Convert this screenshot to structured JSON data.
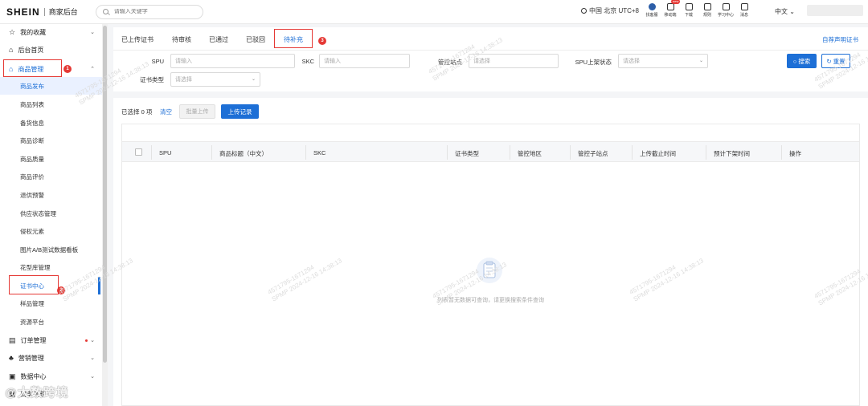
{
  "header": {
    "logo": "SHEIN",
    "subtitle": "商家后台",
    "search_placeholder": "请输入关键字",
    "region": "中国 北京 UTC+8",
    "tools": [
      "找客服",
      "移动端",
      "下载",
      "规则",
      "学习中心",
      "消息"
    ],
    "new_badge": "new",
    "language": "中文"
  },
  "sidebar": {
    "favorites": "我的收藏",
    "home": "后台首页",
    "product_mgmt": "商品管理",
    "sub_items": [
      "商品发布",
      "商品列表",
      "备货信息",
      "商品诊断",
      "商品质量",
      "商品评价",
      "退供预警",
      "供应状态管理",
      "侵权元素",
      "图片A/B测试数据看板",
      "花型库管理",
      "证书中心",
      "样品管理",
      "资源平台"
    ],
    "order_mgmt": "订单管理",
    "marketing_mgmt": "营销管理",
    "data_center": "数据中心",
    "finance_mgmt": "财务管理"
  },
  "annotations": [
    "1",
    "2",
    "3"
  ],
  "tabs": [
    "已上传证书",
    "待审核",
    "已通过",
    "已驳回",
    "待补充"
  ],
  "right_link": "自荐声明证书",
  "filters": {
    "spu_label": "SPU",
    "spu_placeholder": "请输入",
    "skc_label": "SKC",
    "skc_placeholder": "请输入",
    "site_label": "管控站点",
    "site_placeholder": "请选择",
    "status_label": "SPU上架状态",
    "status_placeholder": "请选择",
    "cert_label": "证书类型",
    "cert_placeholder": "请选择",
    "search_btn": "搜索",
    "reset_btn": "重置"
  },
  "toolbar": {
    "selected": "已选择 0 项",
    "clear": "清空",
    "batch_upload": "批量上传",
    "upload_record": "上传记录"
  },
  "table": {
    "columns": [
      "SPU",
      "商品标题（中文）",
      "SKC",
      "证书类型",
      "管控地区",
      "管控子站点",
      "上传截止时间",
      "预计下架时间",
      "操作"
    ],
    "empty_text": "列表暂无数据可查询，请更换搜索条件查询"
  },
  "watermark": {
    "line1": "4571795-1671294",
    "line2": "SPMP 2024-12-16 14:38:13"
  },
  "corner_logo": "@大数跨境",
  "colors": {
    "primary": "#1d6fd6",
    "annotation_red": "#e53935"
  }
}
